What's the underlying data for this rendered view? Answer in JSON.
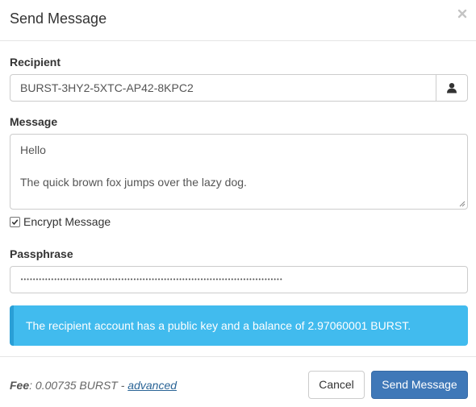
{
  "dialog": {
    "title": "Send Message",
    "close_icon": "close-icon"
  },
  "recipient": {
    "label": "Recipient",
    "value": "BURST-3HY2-5XTC-AP42-8KPC2",
    "contacts_icon": "user-icon"
  },
  "message": {
    "label": "Message",
    "lines": [
      "Hello",
      "",
      "The quick brown fox jumps over the lazy dog."
    ]
  },
  "encrypt": {
    "label": "Encrypt Message",
    "checked": true
  },
  "passphrase": {
    "label": "Passphrase",
    "masked_value": "••••••••••••••••••••••••••••••••••••••••••••••••••••••••••••••••••••••••••••••••••••••"
  },
  "alert": {
    "text": "The recipient account has a public key and a balance of 2.97060001 BURST.",
    "color": "#41bbee"
  },
  "footer": {
    "fee_label": "Fee",
    "fee_value": ": 0.00735 BURST - ",
    "advanced_link": "advanced",
    "cancel_label": "Cancel",
    "send_label": "Send Message",
    "send_color": "#3f78b8"
  }
}
